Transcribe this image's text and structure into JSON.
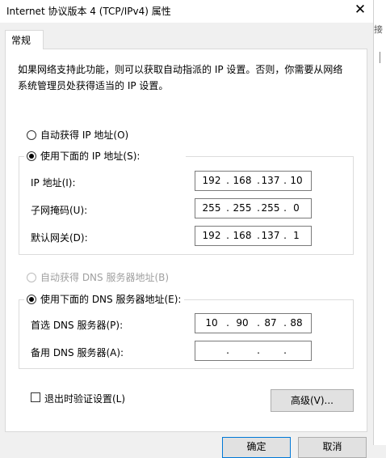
{
  "window": {
    "title": "Internet 协议版本 4 (TCP/IPv4) 属性",
    "close_glyph": "✕"
  },
  "background_window": {
    "partial_text": "接"
  },
  "tab": {
    "label": "常规"
  },
  "description": "如果网络支持此功能，则可以获取自动指派的 IP 设置。否则，你需要从网络系统管理员处获得适当的 IP 设置。",
  "ip_mode": {
    "auto_label": "自动获得 IP 地址(O)",
    "manual_label": "使用下面的 IP 地址(S):",
    "selected": "manual"
  },
  "ip_fields": {
    "ip_label": "IP 地址(I):",
    "ip": [
      "192",
      "168",
      "137",
      "10"
    ],
    "mask_label": "子网掩码(U):",
    "mask": [
      "255",
      "255",
      "255",
      "0"
    ],
    "gateway_label": "默认网关(D):",
    "gateway": [
      "192",
      "168",
      "137",
      "1"
    ]
  },
  "dns_mode": {
    "auto_label": "自动获得 DNS 服务器地址(B)",
    "manual_label": "使用下面的 DNS 服务器地址(E):",
    "selected": "manual",
    "auto_disabled": true
  },
  "dns_fields": {
    "preferred_label": "首选 DNS 服务器(P):",
    "preferred": [
      "10",
      "90",
      "87",
      "88"
    ],
    "alternate_label": "备用 DNS 服务器(A):",
    "alternate": [
      "",
      "",
      "",
      ""
    ]
  },
  "validate_checkbox": {
    "label": "退出时验证设置(L)",
    "checked": false
  },
  "advanced_button": {
    "label": "高级(V)..."
  },
  "footer": {
    "ok_label": "确定",
    "cancel_label": "取消"
  },
  "dot": ".",
  "colors": {
    "window_bg": "#f0f0f0",
    "panel_bg": "#ffffff",
    "disabled_text": "#a0a0a0"
  }
}
